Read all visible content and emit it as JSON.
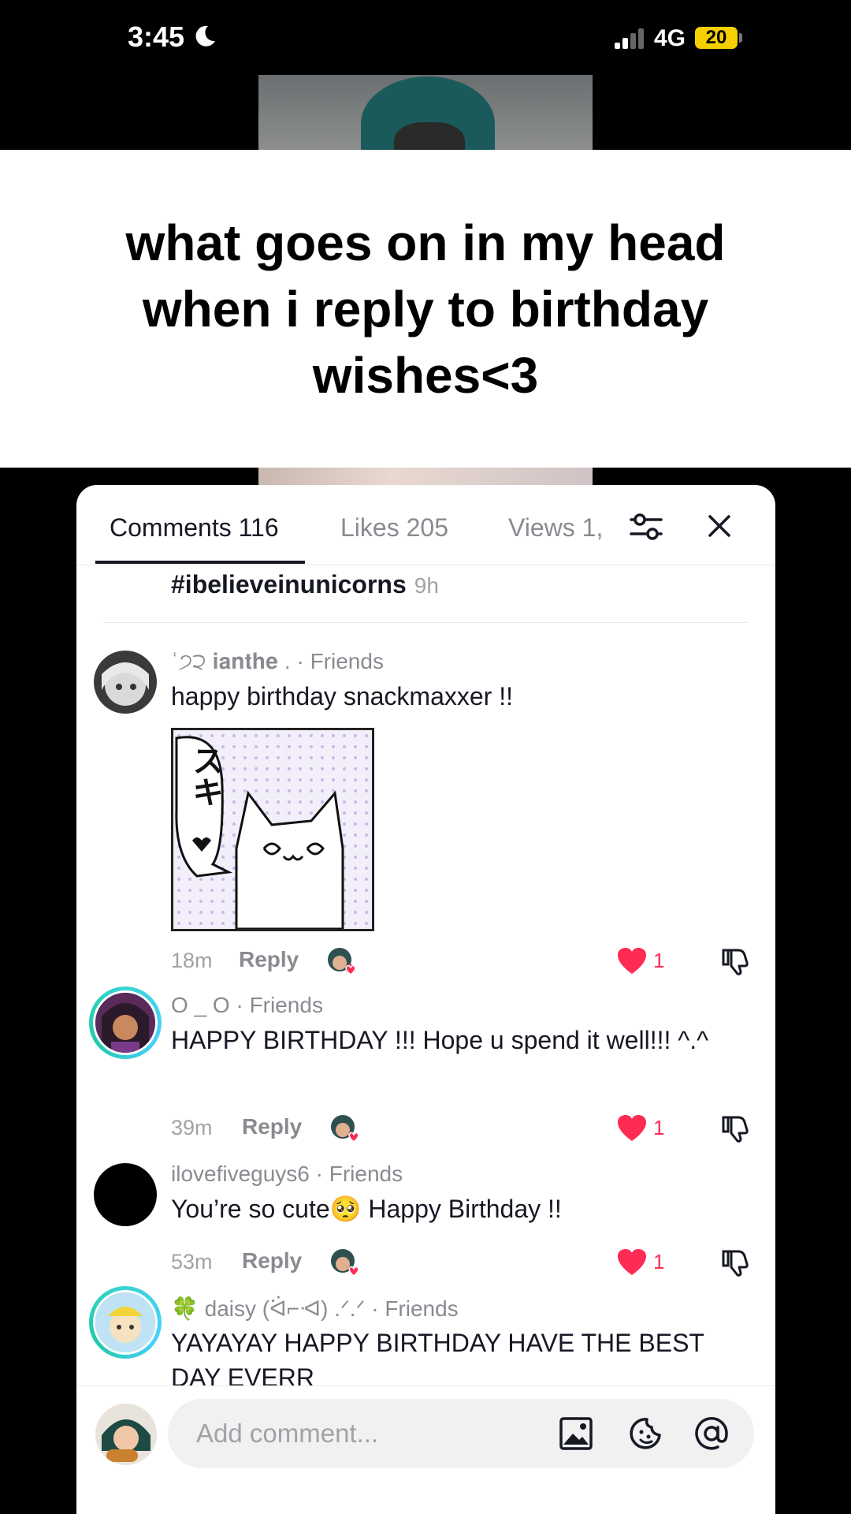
{
  "status_bar": {
    "time": "3:45",
    "network": "4G",
    "battery": "20"
  },
  "video": {
    "caption": "what goes on in my head when i reply to birthday wishes<3"
  },
  "tabs": [
    {
      "label": "Comments 116"
    },
    {
      "label": "Likes 205"
    },
    {
      "label": "Views 1,"
    }
  ],
  "previous_comment": {
    "text": "#ibelieveinunicorns",
    "time": "9h"
  },
  "comments": [
    {
      "username": "ʿ੭੨ 𝐢𝐚𝐧𝐭𝐡𝐞 . · Friends",
      "text": "happy birthday snackmaxxer !!",
      "sticker_text": "スキ",
      "time": "18m",
      "reply": "Reply",
      "likes": "1"
    },
    {
      "username": "O _ O · Friends",
      "text": "HAPPY BIRTHDAY !!! Hope u spend it well!!! ^.^",
      "time": "39m",
      "reply": "Reply",
      "likes": "1"
    },
    {
      "username": "ilovefiveguys6 · Friends",
      "text": "You’re so cute🥺 Happy Birthday !!",
      "time": "53m",
      "reply": "Reply",
      "likes": "1"
    },
    {
      "username": "🍀 daisy (ᐛ⌐ᐗ) .ᐟ.ᐟ · Friends",
      "text": "YAYAYAY HAPPY BIRTHDAY HAVE THE BEST DAY EVERR"
    }
  ],
  "input": {
    "placeholder": "Add comment..."
  },
  "colors": {
    "like": "#fe2c55",
    "ring": "#3ad4d4",
    "text": "#161823",
    "muted": "#8a8b91"
  },
  "icons": [
    "moon-icon",
    "signal-icon",
    "filter-icon",
    "close-icon",
    "heart-icon",
    "dislike-icon",
    "image-icon",
    "emoji-icon",
    "mention-icon"
  ]
}
